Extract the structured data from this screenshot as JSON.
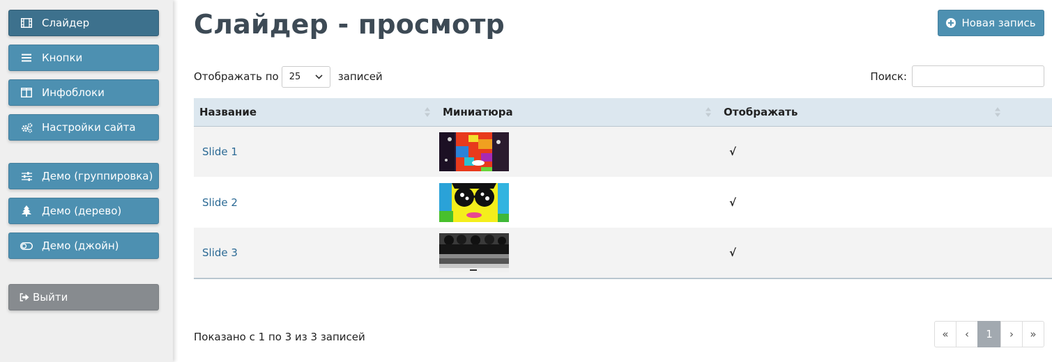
{
  "sidebar": {
    "items": [
      {
        "label": "Слайдер",
        "icon": "film-icon"
      },
      {
        "label": "Кнопки",
        "icon": "list-icon"
      },
      {
        "label": "Инфоблоки",
        "icon": "columns-icon"
      },
      {
        "label": "Настройки сайта",
        "icon": "cogs-icon"
      },
      {
        "label": "Демо (группировка)",
        "icon": "sliders-icon"
      },
      {
        "label": "Демо (дерево)",
        "icon": "tree-icon"
      },
      {
        "label": "Демо (джойн)",
        "icon": "toggle-icon"
      }
    ],
    "logout_label": "Выйти"
  },
  "header": {
    "title": "Слайдер - просмотр",
    "new_button_label": "Новая запись"
  },
  "length": {
    "prefix": "Отображать по",
    "value": "25",
    "suffix": "записей"
  },
  "search": {
    "label": "Поиск:",
    "value": ""
  },
  "table": {
    "columns": [
      "Название",
      "Миниатюра",
      "Отображать"
    ],
    "rows": [
      {
        "name": "Slide 1",
        "thumbnail": "colorful-face-thumbnail",
        "visible": "√"
      },
      {
        "name": "Slide 2",
        "thumbnail": "sunglasses-face-thumbnail",
        "visible": "√"
      },
      {
        "name": "Slide 3",
        "thumbnail": "band-photo-thumbnail",
        "visible": "√"
      }
    ]
  },
  "info": "Показано с 1 по 3 из 3 записей",
  "pagination": {
    "first": "«",
    "prev": "‹",
    "current": "1",
    "next": "›",
    "last": "»"
  },
  "colors": {
    "accent": "#4d90b1",
    "active": "#3d718d",
    "logout": "#878b8f",
    "link": "#2c6a95",
    "header_row": "#dce7ef"
  }
}
